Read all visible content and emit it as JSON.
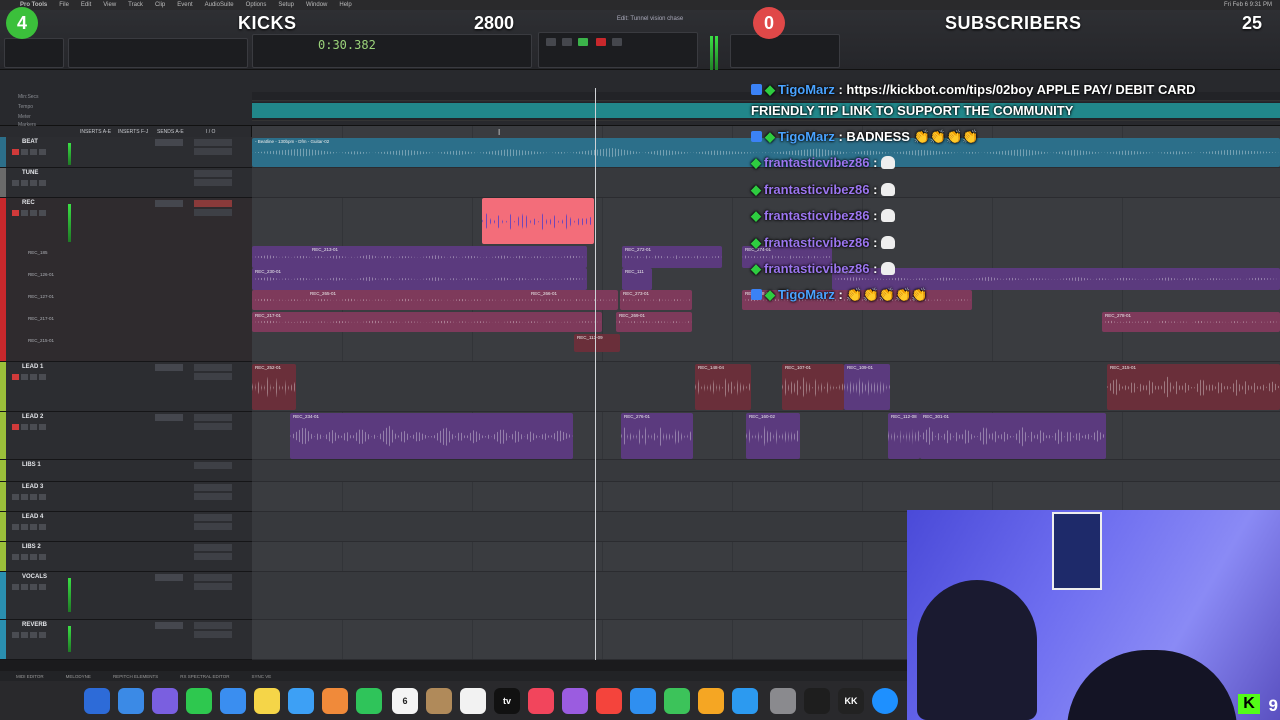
{
  "menubar": {
    "app": "Pro Tools",
    "items": [
      "File",
      "Edit",
      "View",
      "Track",
      "Clip",
      "Event",
      "AudioSuite",
      "Options",
      "Setup",
      "Window",
      "Help"
    ],
    "clock": "Fri Feb 6 9:31 PM"
  },
  "overlay": {
    "kicks_count": "4",
    "kicks_label": "KICKS",
    "kicks_value": "2800",
    "subs_count": "0",
    "subs_label": "SUBSCRIBERS",
    "subs_value": "25",
    "kick_logo": "K",
    "kick_viewers": "9",
    "kicks_color": "#3bc03b",
    "subs_color": "#e04848"
  },
  "toolbar": {
    "counter": "0:30.382",
    "window_title": "Edit: Tunnel vision chase"
  },
  "ruler": {
    "rows": [
      "Min:Secs",
      "Tempo",
      "Meter",
      "Markers"
    ]
  },
  "columns": {
    "inserts_ae": "INSERTS A-E",
    "inserts_fj": "INSERTS F-J",
    "sends_ae": "SENDS A-E",
    "io": "I / O"
  },
  "tracks": [
    {
      "name": "BEAT",
      "color": "#2c6f8a"
    },
    {
      "name": "TUNE",
      "color": "#6a6a6a"
    },
    {
      "name": "REC",
      "color": "#c8282c"
    },
    {
      "name": "LEAD 1",
      "color": "#9bbf3a"
    },
    {
      "name": "LEAD 2",
      "color": "#9bbf3a"
    },
    {
      "name": "LIBS 1",
      "color": "#9bbf3a"
    },
    {
      "name": "LEAD 3",
      "color": "#9bbf3a"
    },
    {
      "name": "LEAD 4",
      "color": "#9bbf3a"
    },
    {
      "name": "LIBS 2",
      "color": "#9bbf3a"
    },
    {
      "name": "VOCALS",
      "color": "#2a8fb0"
    },
    {
      "name": "REVERB",
      "color": "#2a8fb0"
    }
  ],
  "playlists": [
    "REC_185",
    "REC_126-01",
    "REC_127-01",
    "REC_217-01",
    "REC_215-01"
  ],
  "clips": {
    "rec": [
      "REC_213-01",
      "REC_272-01",
      "REC_230-01",
      "REC_111",
      "REC_265-01",
      "REC_266-01",
      "REC_273-01",
      "REC_217-01",
      "REC_269-01",
      "REC_113-09",
      "REC_274-01",
      "REC_148-01",
      "REC_278-01",
      "REC_111-01"
    ],
    "lead1": [
      "REC_252-01",
      "REC_148-04",
      "REC_107-01",
      "REC_109-01",
      "REC_315-01"
    ],
    "lead2": [
      "REC_234-01",
      "REC_276-01",
      "REC_160-02",
      "REC_112-08",
      "REC_301-01"
    ],
    "beat": "- Beatline - 130bpm - Dfm - Guitar-02"
  },
  "chat": [
    {
      "user": "TigoMarz",
      "text": ": https://kickbot.com/tips/02boy APPLE PAY/ DEBIT CARD"
    },
    {
      "user": "",
      "text": "FRIENDLY TIP LINK TO SUPPORT THE COMMUNITY"
    },
    {
      "user": "TigoMarz",
      "text": ": BADNESS 👏👏👏👏"
    },
    {
      "user": "frantasticvibez86",
      "text": ":"
    },
    {
      "user": "frantasticvibez86",
      "text": ":"
    },
    {
      "user": "frantasticvibez86",
      "text": ":"
    },
    {
      "user": "frantasticvibez86",
      "text": ":"
    },
    {
      "user": "frantasticvibez86",
      "text": ":"
    },
    {
      "user": "TigoMarz",
      "text": ": 👏👏👏👏👏"
    }
  ],
  "bottom_bar": [
    "MIDI EDITOR",
    "MELODYNE",
    "REPITCH ELEMENTS",
    "RX SPECTRAL EDITOR",
    "SYNC VE"
  ],
  "dock": {
    "calendar_day": "6",
    "tv_label": "tv",
    "app_label": "KK"
  }
}
